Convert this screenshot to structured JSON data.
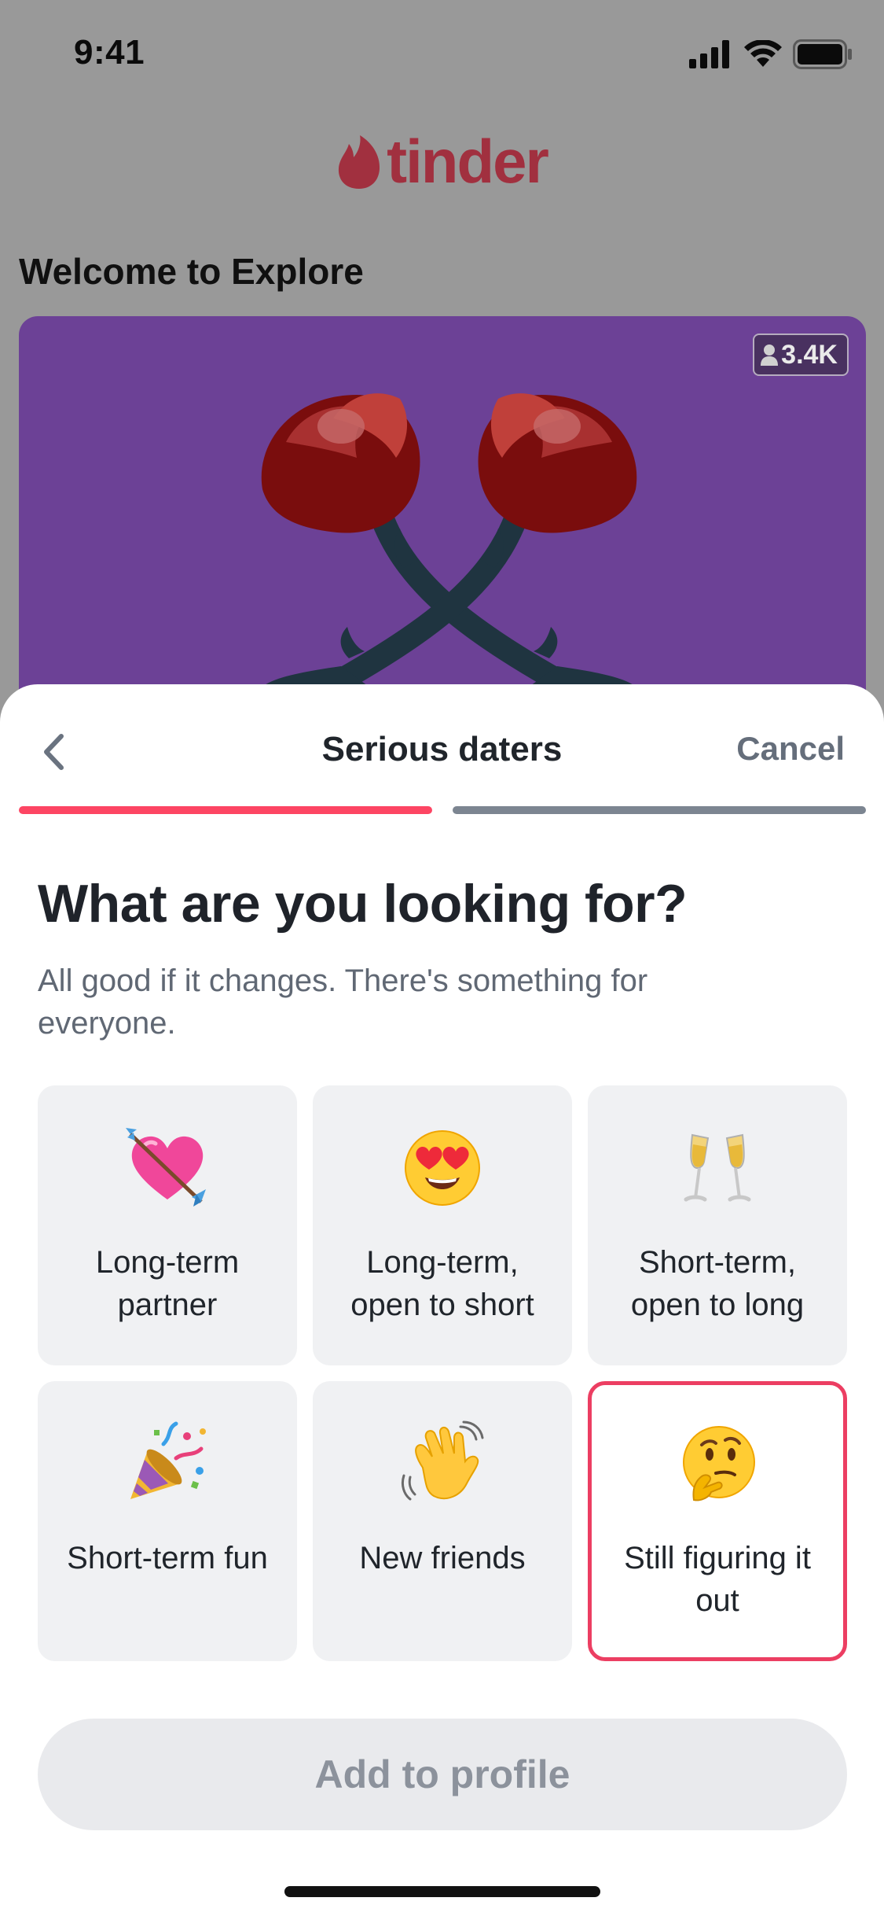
{
  "status_bar": {
    "time": "9:41"
  },
  "background": {
    "logo_text": "tinder",
    "explore_title": "Welcome to Explore",
    "card": {
      "member_count": "3.4K",
      "color": "#6c4196"
    }
  },
  "sheet": {
    "title": "Serious daters",
    "cancel_label": "Cancel",
    "progress_colors": {
      "active": "#fd4563",
      "inactive": "#7c8591"
    },
    "heading": "What are you looking for?",
    "subheading": "All good if it changes. There's something for everyone.",
    "options": [
      {
        "label": "Long-term partner",
        "icon": "heart-with-arrow-icon",
        "selected": false
      },
      {
        "label": "Long-term, open to short",
        "icon": "heart-eyes-face-icon",
        "selected": false
      },
      {
        "label": "Short-term, open to long",
        "icon": "champagne-glasses-icon",
        "selected": false
      },
      {
        "label": "Short-term fun",
        "icon": "party-popper-icon",
        "selected": false
      },
      {
        "label": "New friends",
        "icon": "waving-hand-icon",
        "selected": false
      },
      {
        "label": "Still figuring it out",
        "icon": "thinking-face-icon",
        "selected": true
      }
    ],
    "add_button_label": "Add to profile"
  }
}
